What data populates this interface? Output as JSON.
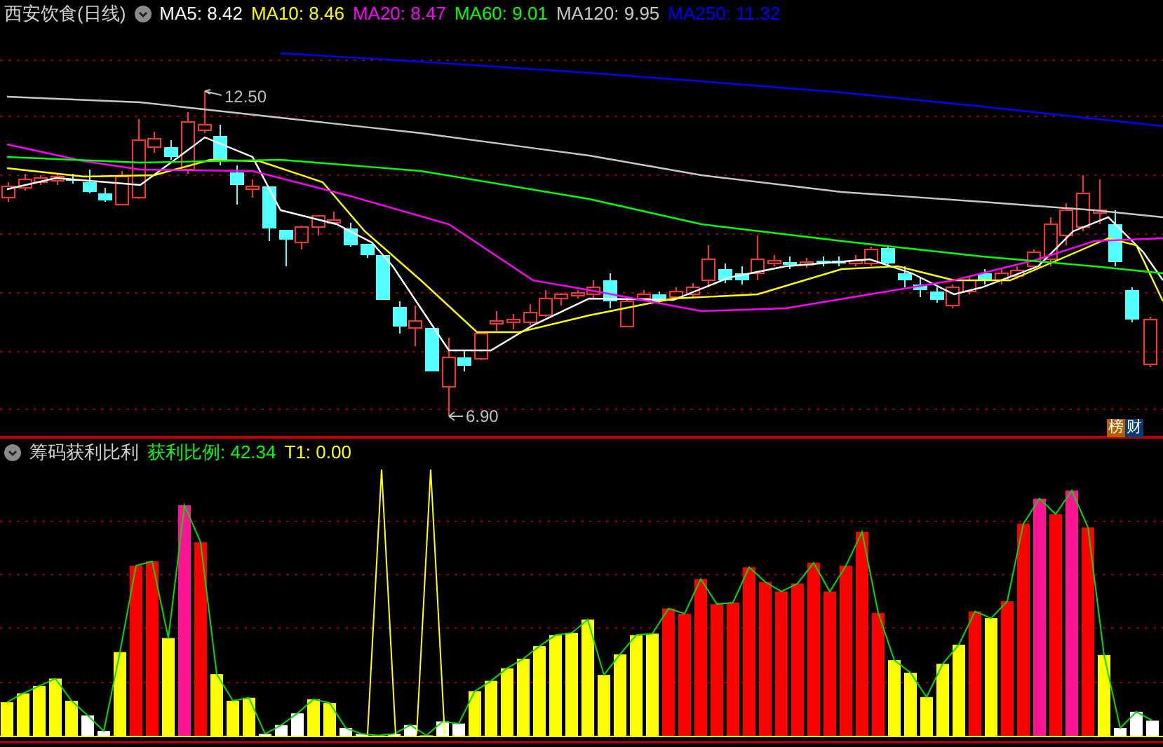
{
  "title": "西安饮食(日线)",
  "moving_averages": [
    {
      "text": "MA5: 8.42",
      "color": "#ffffff"
    },
    {
      "text": "MA10: 8.46",
      "color": "#ffff00"
    },
    {
      "text": "MA20: 8.47",
      "color": "#ff00ff"
    },
    {
      "text": "MA60: 9.01",
      "color": "#00ff00"
    },
    {
      "text": "MA120: 9.95",
      "color": "#c8c8c8"
    },
    {
      "text": "MA250: 11.32",
      "color": "#0000ff"
    }
  ],
  "price_chart": {
    "high_label": "12.50",
    "low_label": "6.90"
  },
  "badge": [
    {
      "text": "榜",
      "color": "#b35c00"
    },
    {
      "text": "财",
      "color": "#0a3a78"
    }
  ],
  "indicator": {
    "title": "筹码获利比利",
    "readings": [
      {
        "text": "获利比例: 42.34",
        "color": "#00ff00"
      },
      {
        "text": "T1: 0.00",
        "color": "#ffff00"
      }
    ]
  }
}
